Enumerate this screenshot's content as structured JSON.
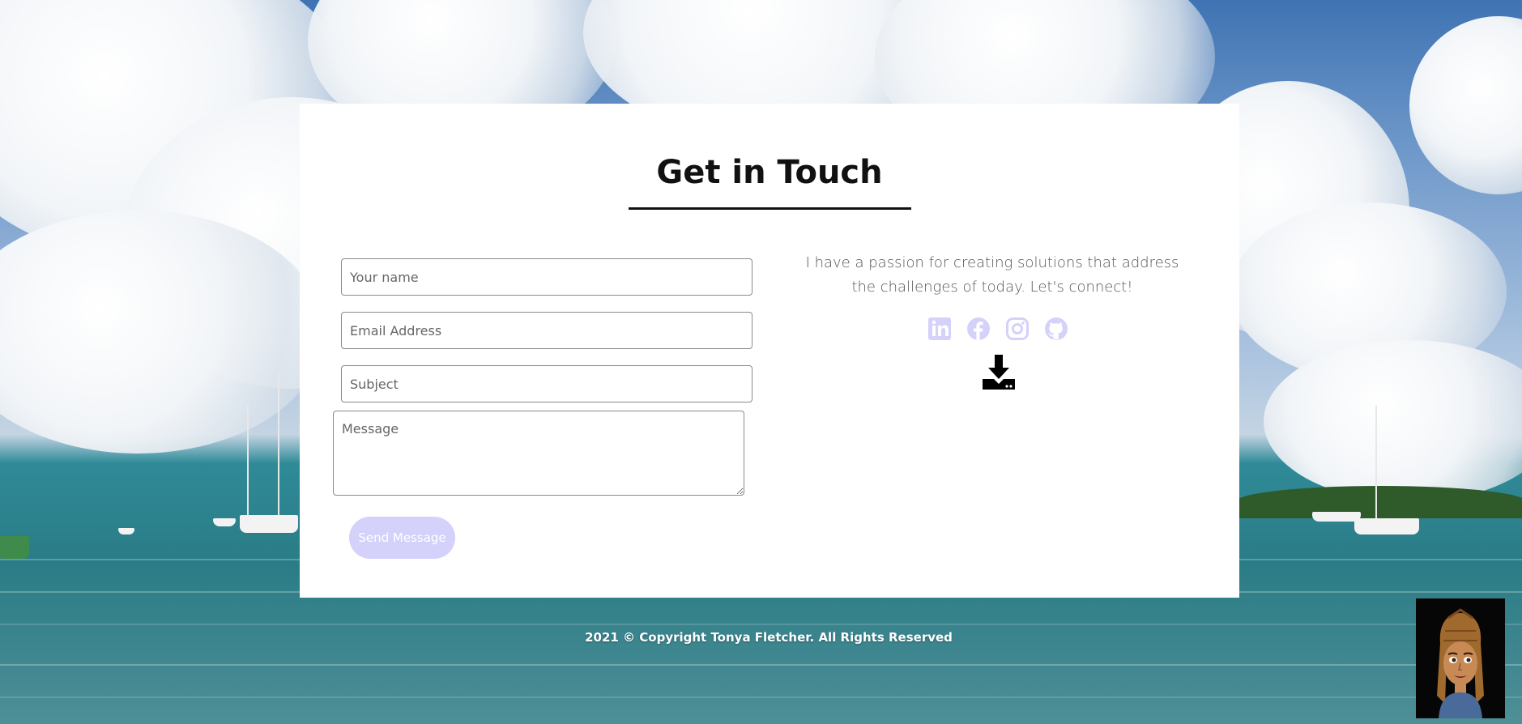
{
  "contact": {
    "title": "Get in Touch",
    "form": {
      "name_placeholder": "Your name",
      "email_placeholder": "Email Address",
      "subject_placeholder": "Subject",
      "message_placeholder": "Message",
      "send_label": "Send Message"
    },
    "blurb": "I have a passion for creating solutions that address the challenges of today. Let's connect!",
    "socials": [
      {
        "icon": "linkedin-icon"
      },
      {
        "icon": "facebook-icon"
      },
      {
        "icon": "instagram-icon"
      },
      {
        "icon": "github-icon"
      }
    ],
    "download_icon": "download-icon"
  },
  "footer": {
    "copyright": "2021 © Copyright Tonya Fletcher. All Rights Reserved"
  },
  "colors": {
    "accent": "#d4d1fb",
    "card_bg": "#ffffff",
    "text_dark": "#111111",
    "footer_text": "#ffffff"
  }
}
